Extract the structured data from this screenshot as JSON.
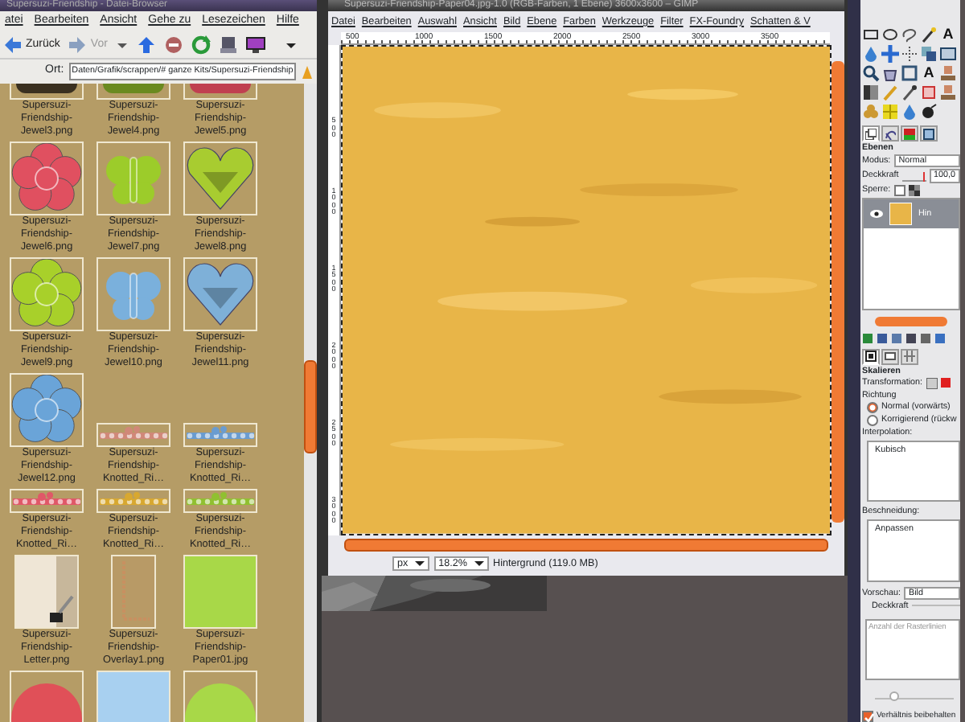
{
  "file_browser": {
    "title": "Supersuzi-Friendship - Datei-Browser",
    "menu": [
      "atei",
      "Bearbeiten",
      "Ansicht",
      "Gehe zu",
      "Lesezeichen",
      "Hilfe"
    ],
    "toolbar": [
      {
        "kind": "back",
        "label": "Zurück",
        "disabled": false
      },
      {
        "kind": "forward",
        "label": "Vor",
        "disabled": true
      },
      {
        "kind": "up"
      },
      {
        "kind": "stop"
      },
      {
        "kind": "reload"
      },
      {
        "kind": "computer"
      },
      {
        "kind": "monitor"
      },
      {
        "kind": "more"
      }
    ],
    "location": {
      "label": "Ort:",
      "value": "Daten/Grafik/scrappen/# ganze Kits/Supersuzi-Friendship"
    },
    "files": [
      {
        "label": "Supersuzi-Friendship-Jewel3.png",
        "kind": "partial",
        "color": "#3a3020"
      },
      {
        "label": "Supersuzi-Friendship-Jewel4.png",
        "kind": "partial",
        "color": "#6a8a20"
      },
      {
        "label": "Supersuzi-Friendship-Jewel5.png",
        "kind": "partial",
        "color": "#c04050"
      },
      {
        "label": "Supersuzi-Friendship-Jewel6.png",
        "kind": "flower",
        "color": "#e05060"
      },
      {
        "label": "Supersuzi-Friendship-Jewel7.png",
        "kind": "butterfly",
        "color": "#9ccc2a"
      },
      {
        "label": "Supersuzi-Friendship-Jewel8.png",
        "kind": "heart",
        "color": "#a8cc30"
      },
      {
        "label": "Supersuzi-Friendship-Jewel9.png",
        "kind": "flower",
        "color": "#a8d02a"
      },
      {
        "label": "Supersuzi-Friendship-Jewel10.png",
        "kind": "butterfly",
        "color": "#7ab0dc"
      },
      {
        "label": "Supersuzi-Friendship-Jewel11.png",
        "kind": "heart",
        "color": "#7eb0d8"
      },
      {
        "label": "Supersuzi-Friendship-Jewel12.png",
        "kind": "flower",
        "color": "#6aa4d8"
      },
      {
        "label": "Supersuzi-Friendship-Knotted_Ri…",
        "kind": "ribbon",
        "color": "#d08878"
      },
      {
        "label": "Supersuzi-Friendship-Knotted_Ri…",
        "kind": "ribbon",
        "color": "#6a9cd0"
      },
      {
        "label": "Supersuzi-Friendship-Knotted_Ri…",
        "kind": "ribbon",
        "color": "#e05868"
      },
      {
        "label": "Supersuzi-Friendship-Knotted_Ri…",
        "kind": "ribbon",
        "color": "#d8a830"
      },
      {
        "label": "Supersuzi-Friendship-Knotted_Ri…",
        "kind": "ribbon",
        "color": "#90c030"
      },
      {
        "label": "Supersuzi-Friendship-Letter.png",
        "kind": "letter",
        "color": "#efe6d6"
      },
      {
        "label": "Supersuzi-Friendship-Overlay1.png",
        "kind": "overlay",
        "color": "#c89060"
      },
      {
        "label": "Supersuzi-Friendship-Paper01.jpg",
        "kind": "paper",
        "color": "#a8d848"
      },
      {
        "kind": "scallop",
        "color": "#e05058"
      },
      {
        "kind": "paper",
        "color": "#a8d0f0"
      },
      {
        "kind": "scallop",
        "color": "#a8d848"
      }
    ]
  },
  "image_window": {
    "title": "Supersuzi-Friendship-Paper04.jpg-1.0 (RGB-Farben, 1 Ebene) 3600x3600 – GIMP",
    "menu": [
      "Datei",
      "Bearbeiten",
      "Auswahl",
      "Ansicht",
      "Bild",
      "Ebene",
      "Farben",
      "Werkzeuge",
      "Filter",
      "FX-Foundry",
      "Schatten & V"
    ],
    "ruler_labels": [
      "500",
      "1000",
      "1500",
      "2000",
      "2500",
      "3000",
      "3500"
    ],
    "vertical_ruler_labels": [
      "500",
      "1000",
      "1500",
      "2000",
      "2500",
      "3000"
    ],
    "status": {
      "unit": "px",
      "zoom": "18.2%",
      "info": "Hintergrund (119.0 MB)"
    }
  },
  "toolbox": {
    "tools": [
      {
        "kind": "square"
      },
      {
        "kind": "ellipse"
      },
      {
        "kind": "lasso"
      },
      {
        "kind": "wand"
      },
      {
        "kind": "letter",
        "glyph": "A"
      },
      {
        "kind": "drop"
      },
      {
        "kind": "cross"
      },
      {
        "kind": "dots"
      },
      {
        "kind": "stack"
      },
      {
        "kind": "box"
      },
      {
        "kind": "zoom"
      },
      {
        "kind": "bucket"
      },
      {
        "kind": "frame"
      },
      {
        "kind": "letter",
        "glyph": "A"
      },
      {
        "kind": "stamp"
      },
      {
        "kind": "gradient"
      },
      {
        "kind": "pencil"
      },
      {
        "kind": "brush"
      },
      {
        "kind": "eraser"
      },
      {
        "kind": "stamp"
      },
      {
        "kind": "smudge"
      },
      {
        "kind": "grid"
      },
      {
        "kind": "drop"
      },
      {
        "kind": "blob"
      }
    ]
  },
  "layers_dock": {
    "tabs": [
      {
        "kind": "layers",
        "selected": true
      },
      {
        "kind": "channels",
        "selected": false
      },
      {
        "kind": "colors",
        "selected": false
      },
      {
        "kind": "box",
        "selected": false
      }
    ],
    "title": "Ebenen",
    "mode_label": "Modus:",
    "mode": "Normal",
    "opacity_label": "Deckkraft",
    "opacity": "100,0",
    "opacity_slider": {
      "level": 0.9
    },
    "lock_label": "Sperre:",
    "lock_pixels": {
      "checked": false
    },
    "layers": [
      {
        "name": "Hin",
        "visible": true,
        "selected": true
      }
    ]
  },
  "tool_options": {
    "tabs": [
      {
        "kind": "options",
        "selected": true
      },
      {
        "kind": "device",
        "selected": false
      },
      {
        "kind": "grid",
        "selected": false
      }
    ],
    "title": "Skalieren",
    "transform_label": "Transformation:",
    "direction_label": "Richtung",
    "directions": [
      {
        "label": "Normal (vorwärts)",
        "selected": true
      },
      {
        "label": "Korrigierend (rückw",
        "selected": false
      }
    ],
    "interpolation_label": "Interpolation:",
    "interpolation": "Kubisch",
    "clipping_label": "Beschneidung:",
    "clipping": "Anpassen",
    "preview_label": "Vorschau:",
    "preview": "Bild",
    "preview_opacity_label": "Deckkraft",
    "grid_lines": {
      "label": "Anzahl der Rasterlinien",
      "disabled": true
    },
    "grid_slider": {
      "level": 0.25
    },
    "keep_ratio": {
      "label": "Verhältnis beibehalten",
      "checked": true
    }
  }
}
